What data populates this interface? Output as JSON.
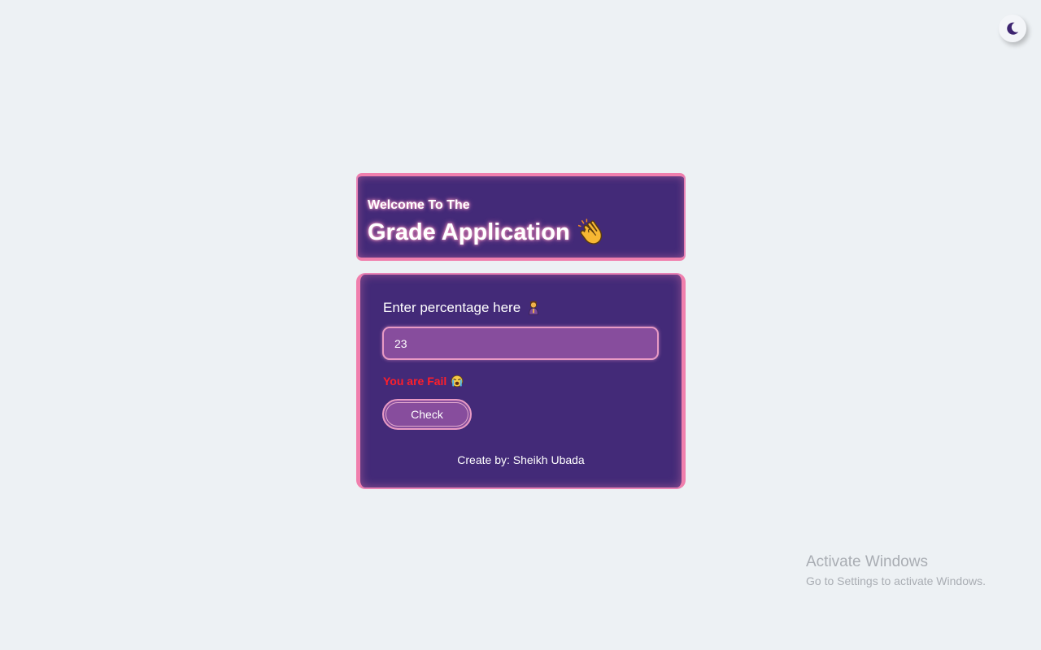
{
  "theme_toggle": {
    "icon": "moon-icon",
    "color": "#3d2470"
  },
  "header": {
    "subtitle": "Welcome To The",
    "title": "Grade Application",
    "title_icon": "clapping-hands-icon"
  },
  "form": {
    "prompt_label": "Enter percentage here",
    "prompt_icon": "praying-person-icon",
    "input_value": "23",
    "result_text": "You are Fail",
    "result_icon": "crying-face-icon",
    "result_color": "#ff1f2a",
    "check_button_label": "Check",
    "credit": "Create by: Sheikh Ubada"
  },
  "watermark": {
    "title": "Activate Windows",
    "subtitle": "Go to Settings to activate Windows."
  },
  "colors": {
    "background": "#edf1f4",
    "card": "#432a78",
    "accent_border": "#f07fad",
    "input_fill": "#874d9d"
  }
}
